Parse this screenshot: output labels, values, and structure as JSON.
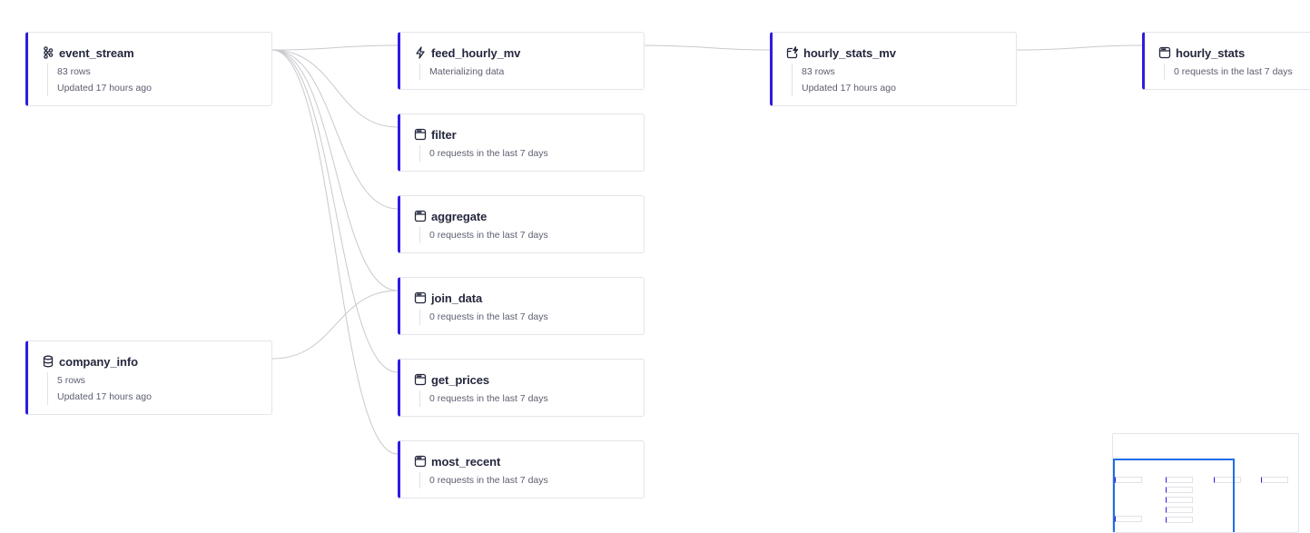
{
  "accent_color": "#2e1ce0",
  "nodes": {
    "event_stream": {
      "name": "event_stream",
      "icon": "kafka-icon",
      "line1": "83 rows",
      "line2": "Updated 17 hours ago"
    },
    "company_info": {
      "name": "company_info",
      "icon": "database-icon",
      "line1": "5 rows",
      "line2": "Updated 17 hours ago"
    },
    "feed_hourly_mv": {
      "name": "feed_hourly_mv",
      "icon": "lightning-icon",
      "line1": "Materializing data"
    },
    "filter": {
      "name": "filter",
      "icon": "endpoint-icon",
      "line1": "0 requests in the last 7 days"
    },
    "aggregate": {
      "name": "aggregate",
      "icon": "endpoint-icon",
      "line1": "0 requests in the last 7 days"
    },
    "join_data": {
      "name": "join_data",
      "icon": "endpoint-icon",
      "line1": "0 requests in the last 7 days"
    },
    "get_prices": {
      "name": "get_prices",
      "icon": "endpoint-icon",
      "line1": "0 requests in the last 7 days"
    },
    "most_recent": {
      "name": "most_recent",
      "icon": "endpoint-icon",
      "line1": "0 requests in the last 7 days"
    },
    "hourly_stats_mv": {
      "name": "hourly_stats_mv",
      "icon": "materialized-view-icon",
      "line1": "83 rows",
      "line2": "Updated 17 hours ago"
    },
    "hourly_stats": {
      "name": "hourly_stats",
      "icon": "endpoint-icon",
      "line1": "0 requests in the last 7 days"
    }
  }
}
